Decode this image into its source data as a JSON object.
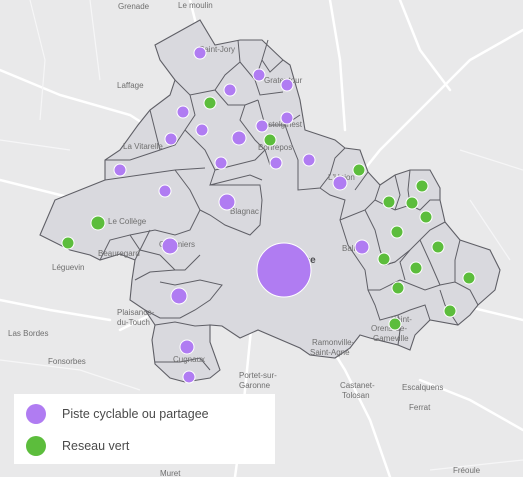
{
  "colors": {
    "background": "#e9e9ea",
    "region_fill": "#d9d9de",
    "region_stroke": "#5f5f66",
    "road": "#ffffff",
    "bike": "#b07cf2",
    "green": "#5cbd3c",
    "label": "#6f6f6f"
  },
  "legend": {
    "items": [
      {
        "label": "Piste cyclable ou partagee",
        "color": "#b07cf2",
        "icon": "purple-circle-icon"
      },
      {
        "label": "Reseau vert",
        "color": "#5cbd3c",
        "icon": "green-circle-icon"
      }
    ]
  },
  "labels": {
    "grenade": "Grenade",
    "le_moulin": "Le moulin",
    "laffage": "Laffage",
    "saint_jory": "Saint-Jory",
    "gratentour": "Gratentour",
    "castelginest": "Castelginest",
    "la_vitarelle": "La Vitarelle",
    "bonrepos": "Bonrepos",
    "l_union": "L'Union",
    "le_college": "Le Collège",
    "blagnac": "Blagnac",
    "toulouse": "Toulouse",
    "balma": "Balma",
    "beauregard": "Beauregard",
    "colomiers": "Colomiers",
    "leguevin": "Léguevin",
    "plaisance": "Plaisance-",
    "du_touch": "du-Touch",
    "las_bordes": "Las Bordes",
    "saint_orens": "Saint-",
    "orens_de": "Orens-de-",
    "gameville": "Gameville",
    "fonsorbes": "Fonsorbes",
    "cugnaux": "Cugnaux",
    "ramonville": "Ramonville-",
    "saint_agne": "Saint-Agne",
    "portet": "Portet-sur-",
    "garonne": "Garonne",
    "castanet": "Castanet-",
    "tolosan": "Tolosan",
    "escalquens": "Escalquens",
    "ferrat": "Ferrat",
    "muret": "Muret",
    "freoule": "Fréoule"
  }
}
